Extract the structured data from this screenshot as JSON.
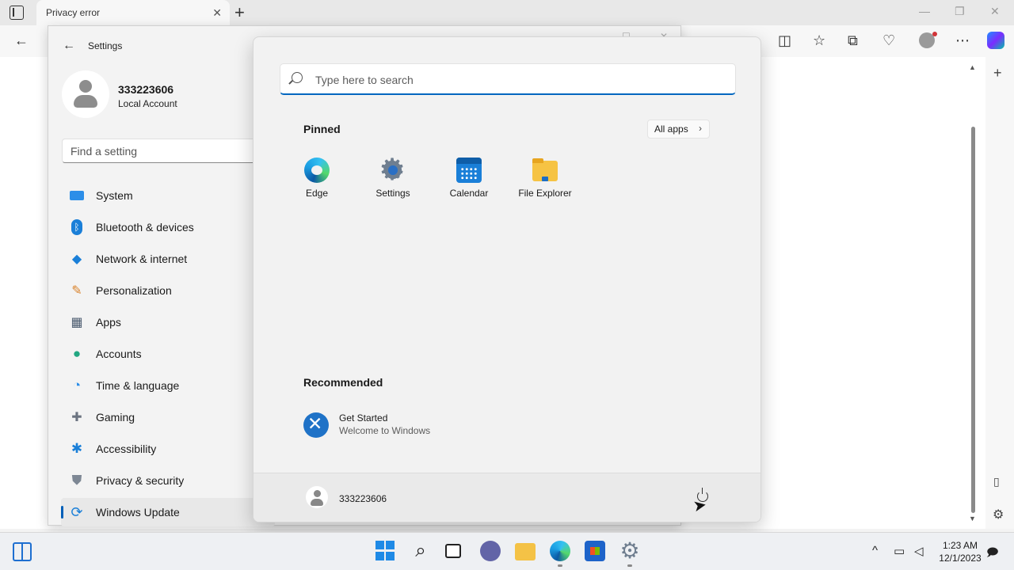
{
  "browser": {
    "tab_title": "Privacy error",
    "new_tab_symbol": "+",
    "close_symbol": "✕",
    "back_symbol": "←"
  },
  "settings": {
    "title": "Settings",
    "back_symbol": "←",
    "user": {
      "name": "333223606",
      "account_type": "Local Account"
    },
    "find_placeholder": "Find a setting",
    "nav": [
      {
        "label": "System",
        "icon": "system-icon"
      },
      {
        "label": "Bluetooth & devices",
        "icon": "bluetooth-icon"
      },
      {
        "label": "Network & internet",
        "icon": "wifi-icon"
      },
      {
        "label": "Personalization",
        "icon": "brush-icon"
      },
      {
        "label": "Apps",
        "icon": "apps-icon"
      },
      {
        "label": "Accounts",
        "icon": "accounts-icon"
      },
      {
        "label": "Time & language",
        "icon": "globe-clock-icon"
      },
      {
        "label": "Gaming",
        "icon": "gamepad-icon"
      },
      {
        "label": "Accessibility",
        "icon": "accessibility-icon"
      },
      {
        "label": "Privacy & security",
        "icon": "shield-icon"
      },
      {
        "label": "Windows Update",
        "icon": "update-icon"
      }
    ],
    "selected": "Windows Update"
  },
  "start_menu": {
    "search_placeholder": "Type here to search",
    "pinned_title": "Pinned",
    "all_apps_label": "All apps",
    "all_apps_chevron": "›",
    "pinned": [
      {
        "label": "Edge",
        "icon": "edge-icon"
      },
      {
        "label": "Settings",
        "icon": "settings-gear-icon"
      },
      {
        "label": "Calendar",
        "icon": "calendar-icon"
      },
      {
        "label": "File Explorer",
        "icon": "folder-icon"
      }
    ],
    "recommended_title": "Recommended",
    "recommended": [
      {
        "title": "Get Started",
        "subtitle": "Welcome to Windows",
        "icon": "get-started-icon"
      }
    ],
    "footer_user": "333223606"
  },
  "taskbar": {
    "time": "1:23 AM",
    "date": "12/1/2023",
    "tray_chevron": "^"
  },
  "colors": {
    "accent": "#005fb8",
    "search_underline": "#0067c0"
  }
}
